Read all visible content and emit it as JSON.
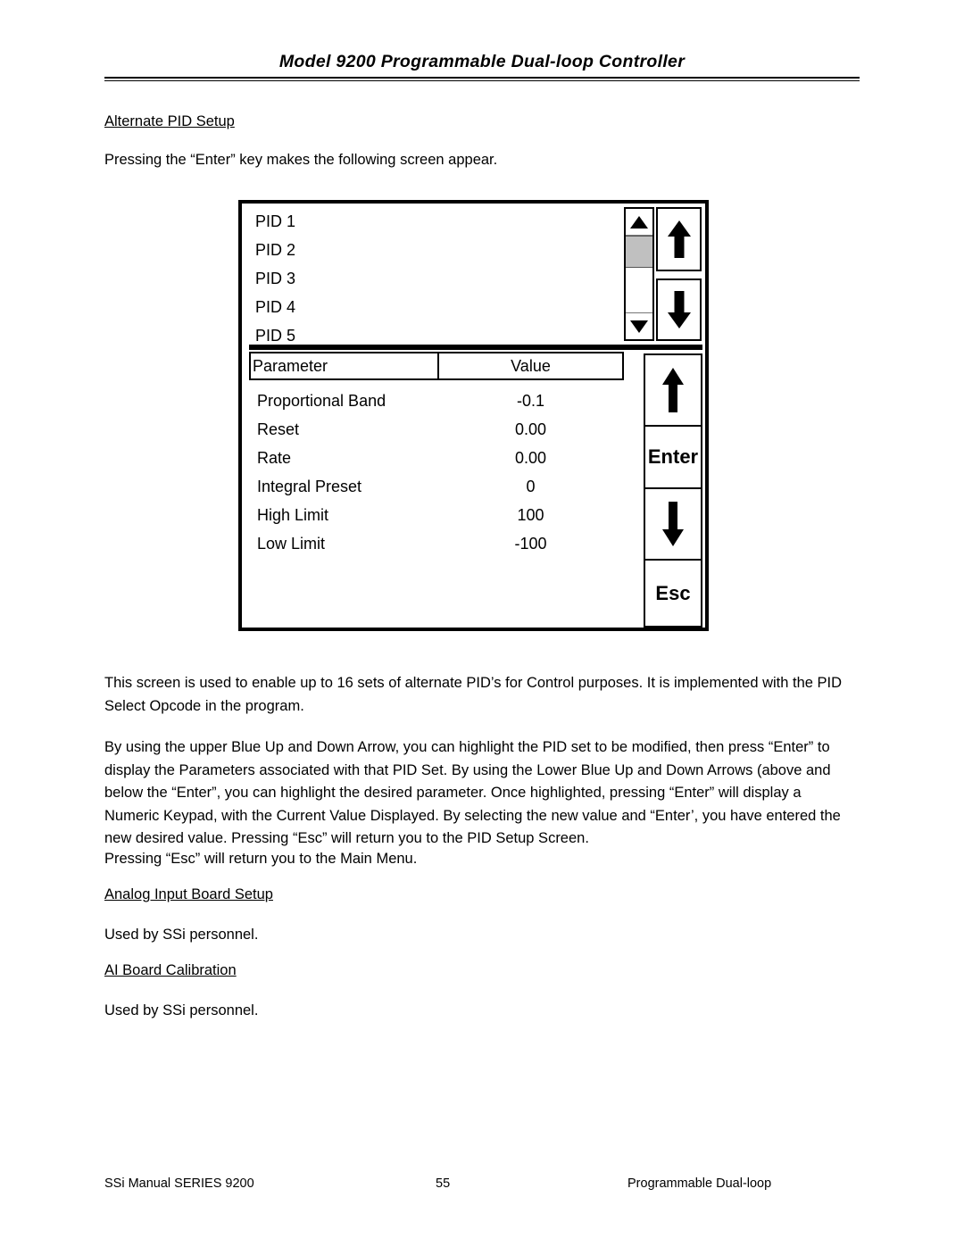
{
  "page": {
    "header_title": "Model 9200 Programmable Dual-loop Controller",
    "sections": {
      "alternate_pid_setup_heading": "Alternate PID Setup",
      "intro_paragraph": "Pressing the “Enter” key makes the following screen appear.",
      "paragraph_1": "This screen is used to enable up to 16 sets of alternate PID’s for Control purposes. It is implemented with the PID Select Opcode in the program.",
      "paragraph_2": "By using the upper Blue Up and Down Arrow, you can highlight the PID set to be modified, then press “Enter” to display the Parameters associated with that PID Set. By using the Lower Blue Up and Down Arrows (above and below the “Enter”, you can highlight the desired parameter. Once highlighted, pressing “Enter” will display a Numeric Keypad, with the Current Value Displayed. By selecting the new value and “Enter’, you have entered the new desired value. Pressing “Esc” will return you to the PID Setup Screen.",
      "paragraph_3": "Pressing “Esc” will return you to the Main Menu.",
      "analog_input_board_setup_heading": "Analog Input Board Setup",
      "analog_input_board_setup_text": "Used by SSi personnel.",
      "ai_board_calibration_heading": "AI Board Calibration",
      "ai_board_calibration_text": "Used by SSi personnel."
    },
    "footer": {
      "left": "SSi Manual SERIES 9200",
      "center": "55",
      "right": "Programmable Dual-loop"
    }
  },
  "figure": {
    "pid_list": [
      {
        "label": "PID 1"
      },
      {
        "label": "PID 2"
      },
      {
        "label": "PID 3"
      },
      {
        "label": "PID 4"
      },
      {
        "label": "PID 5"
      }
    ],
    "scrollbar": {
      "up_icon": "triangle-up-icon",
      "down_icon": "triangle-down-icon",
      "thumb_color": "#c0c0c0",
      "thumb_position_index": 1
    },
    "upper_arrow_buttons": [
      {
        "name": "upper-up-arrow-button",
        "icon": "arrow-up-icon"
      },
      {
        "name": "upper-down-arrow-button",
        "icon": "arrow-down-icon"
      }
    ],
    "parameter_table": {
      "columns": [
        "Parameter",
        "Value"
      ],
      "rows": [
        {
          "parameter": "Proportional Band",
          "value": "-0.1"
        },
        {
          "parameter": "Reset",
          "value": "0.00"
        },
        {
          "parameter": "Rate",
          "value": "0.00"
        },
        {
          "parameter": "Integral Preset",
          "value": "0"
        },
        {
          "parameter": "High Limit",
          "value": "100"
        },
        {
          "parameter": "Low Limit",
          "value": "-100"
        }
      ]
    },
    "keypad": [
      {
        "name": "keypad-up-button",
        "label": "",
        "icon": "arrow-up-icon"
      },
      {
        "name": "keypad-enter-button",
        "label": "Enter",
        "icon": ""
      },
      {
        "name": "keypad-down-button",
        "label": "",
        "icon": "arrow-down-icon"
      },
      {
        "name": "keypad-esc-button",
        "label": "Esc",
        "icon": ""
      }
    ]
  }
}
